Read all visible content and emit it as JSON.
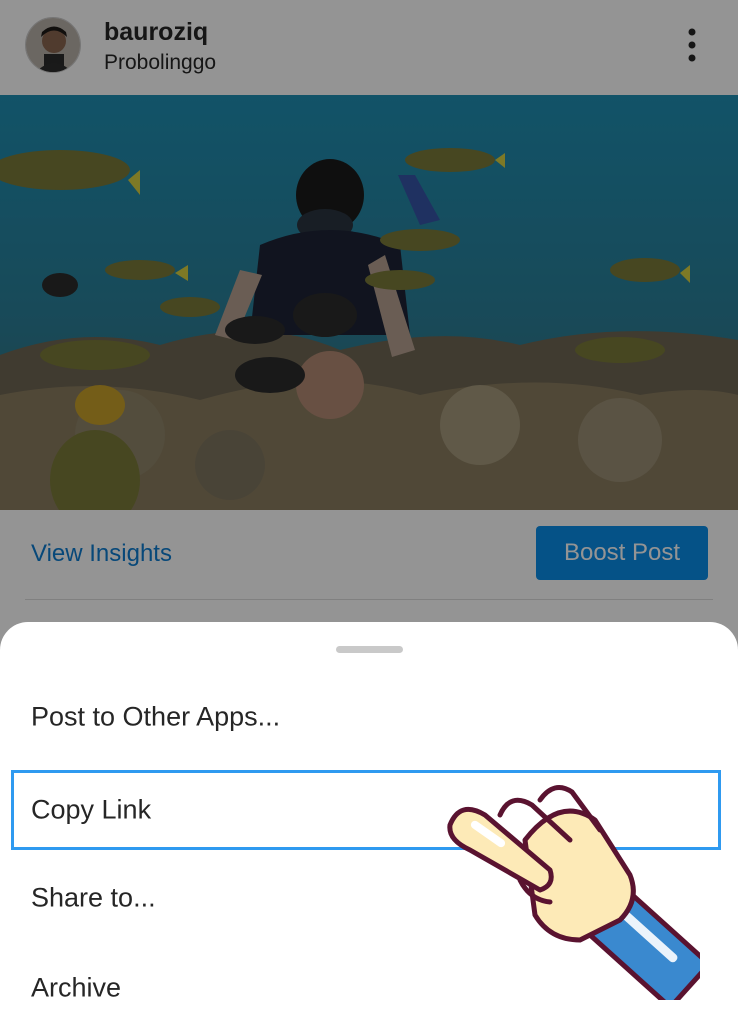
{
  "post": {
    "username": "bauroziq",
    "location": "Probolinggo",
    "more_icon": "more-vertical-icon",
    "photo_alt": "underwater snorkeling photo with fish and coral"
  },
  "actions": {
    "view_insights": "View Insights",
    "boost_post": "Boost Post",
    "accent_color": "#0a8de8"
  },
  "sheet": {
    "handle_icon": "drag-handle",
    "items": [
      {
        "label": "Post to Other Apps..."
      },
      {
        "label": "Copy Link",
        "highlighted": true
      },
      {
        "label": "Share to..."
      },
      {
        "label": "Archive"
      }
    ],
    "highlight_color": "#2f9af0"
  },
  "overlay": {
    "pointer_icon": "pointing-hand-icon"
  }
}
